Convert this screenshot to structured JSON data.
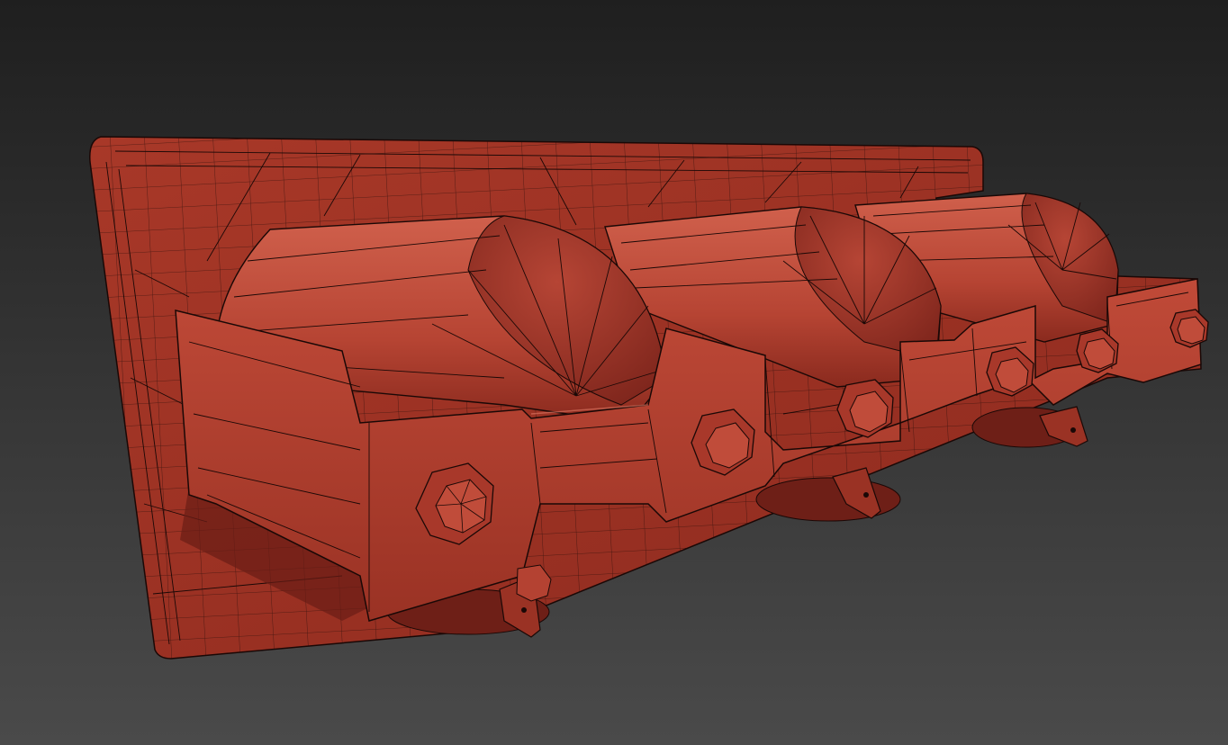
{
  "viewport": {
    "background_top": "#1f1f1f",
    "background_bottom": "#4a4a4a"
  },
  "model": {
    "base_color": "#b23b2c",
    "light_color": "#cf5a47",
    "shadow_color": "#6e1f17",
    "wire_color": "#1a0806",
    "part_count_cylinders": 3
  }
}
